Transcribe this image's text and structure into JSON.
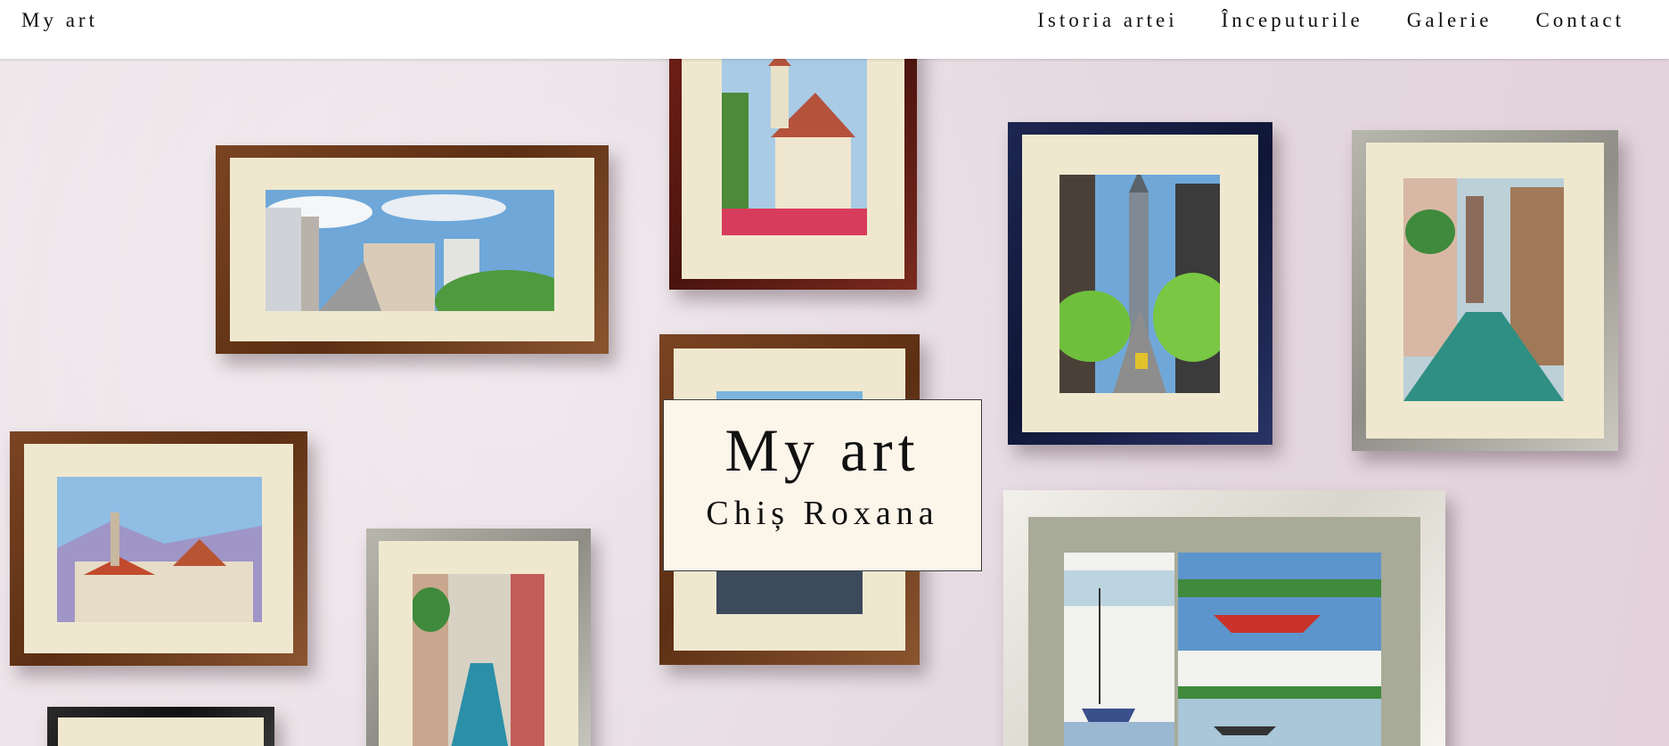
{
  "nav": {
    "brand": "My art",
    "links": [
      "Istoria artei",
      "Începuturile",
      "Galerie",
      "Contact"
    ]
  },
  "hero": {
    "title": "My art",
    "subtitle": "Chiș Roxana",
    "background_image": "wall-of-framed-watercolor-paintings"
  },
  "colors": {
    "nav_background": "#ffffff",
    "title_card_background": "#fcf5ea",
    "wall": "#e9dde3"
  }
}
